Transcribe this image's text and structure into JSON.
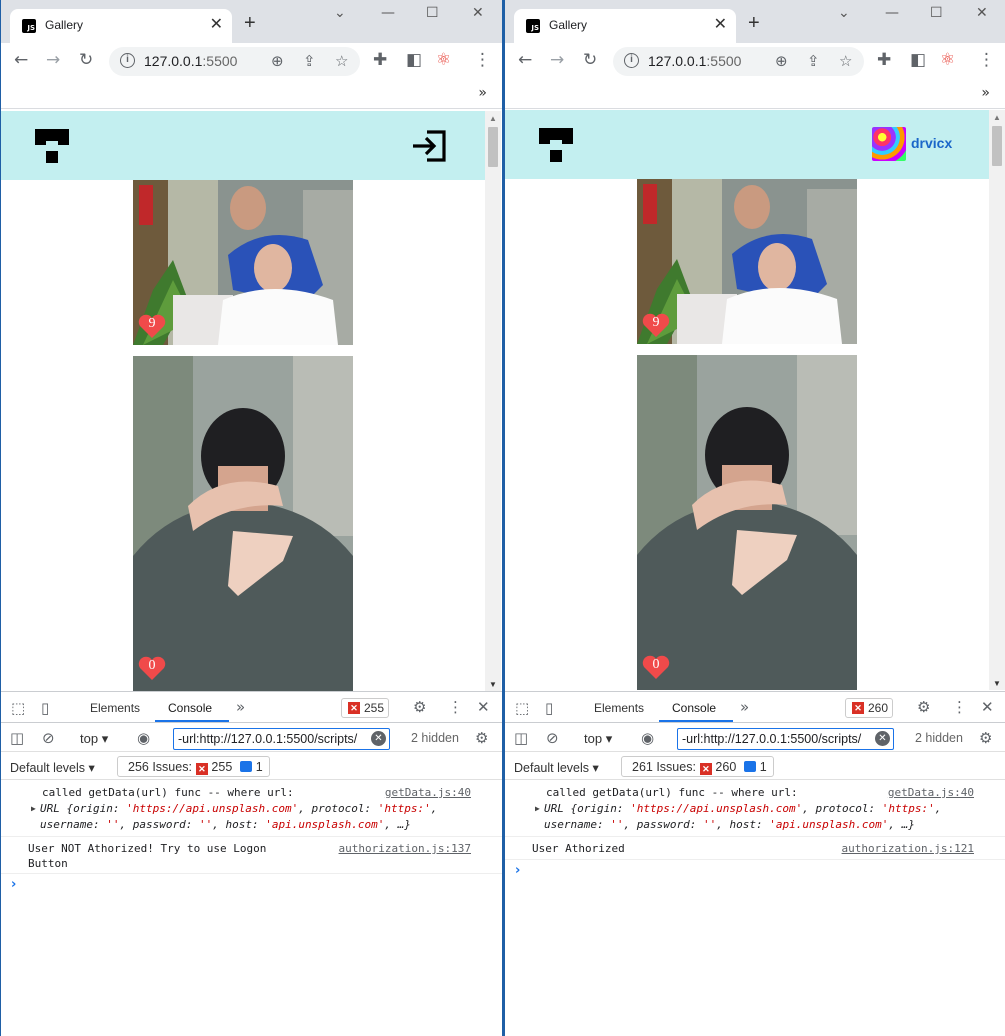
{
  "browser": {
    "tab_title": "Gallery",
    "favicon_text": "JS",
    "url_host": "127.0.0.1",
    "url_port": ":5500"
  },
  "gallery": {
    "photo1_likes": "9",
    "photo2_likes": "0",
    "heart_color": "#f04a4a",
    "header_color": "#c3eff0"
  },
  "left": {
    "error_count": "255",
    "issues_label": "256 Issues:",
    "issues_errors": "255",
    "issues_info": "1",
    "auth_message_line1": "User NOT Athorized! Try to use Logon",
    "auth_message_line2": "Button",
    "auth_source": "authorization.js:137"
  },
  "right": {
    "username": "drvicx",
    "error_count": "260",
    "issues_label": "261 Issues:",
    "issues_errors": "260",
    "issues_info": "1",
    "auth_message_line1": "User Athorized",
    "auth_source": "authorization.js:121"
  },
  "devtools": {
    "tab_elements": "Elements",
    "tab_console": "Console",
    "context": "top",
    "filter_value": "-url:http://127.0.0.1:5500/scripts/",
    "hidden": "2 hidden",
    "levels": "Default levels",
    "log1_line1": "called getData(url) func -- where url:",
    "log1_source": "getData.js:40",
    "log1_url_prefix": "URL {origin: ",
    "log1_origin": "'https://api.unsplash.com'",
    "log1_protocol_key": ", protocol: ",
    "log1_protocol": "'https:'",
    "log1_line3_a": "username: ",
    "log1_empty": "''",
    "log1_line3_b": ", password: ",
    "log1_line3_c": ", host: ",
    "log1_host": "'api.unsplash.com'",
    "log1_line3_d": ", …}"
  }
}
